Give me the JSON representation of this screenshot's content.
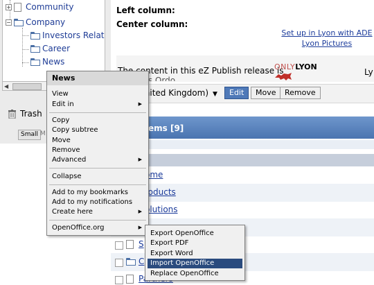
{
  "tree": {
    "nodes": [
      {
        "label": "Community"
      },
      {
        "label": "Company"
      },
      {
        "label": "Investors Relati"
      },
      {
        "label": "Career"
      },
      {
        "label": "News"
      }
    ],
    "trash_label": "Trash",
    "size_small": "Small",
    "size_medium": "M"
  },
  "main": {
    "left_column_label": "Left column:",
    "center_column_label": "Center column:",
    "lyon_link_line1": "Set up in Lyon with ADE",
    "lyon_link_line2": "Lyon Pictures",
    "release_text": "The content in this eZ Publish release is",
    "release_text2": "eZ Sy...s    Ordo...",
    "logo_only": "ONLY",
    "logo_lyon": "LYON",
    "ly_text": "Ly",
    "language_value": "United Kingdom)",
    "edit_label": "Edit",
    "move_label": "Move",
    "remove_label": "Remove",
    "items_header": "ems [9]",
    "rows": [
      "ome",
      "roducts",
      "olutions",
      "",
      "S",
      "C",
      "Partners"
    ]
  },
  "context_menu": {
    "title": "News",
    "items": {
      "view": "View",
      "edit_in": "Edit in",
      "copy": "Copy",
      "copy_subtree": "Copy subtree",
      "move": "Move",
      "remove": "Remove",
      "advanced": "Advanced",
      "collapse": "Collapse",
      "add_bookmarks": "Add to my bookmarks",
      "add_notifications": "Add to my notifications",
      "create_here": "Create here",
      "openoffice": "OpenOffice.org"
    }
  },
  "sub_menu": {
    "items": [
      "Export OpenOffice",
      "Export PDF",
      "Export Word",
      "Import OpenOffice",
      "Replace OpenOffice"
    ],
    "selected_index": 3
  }
}
